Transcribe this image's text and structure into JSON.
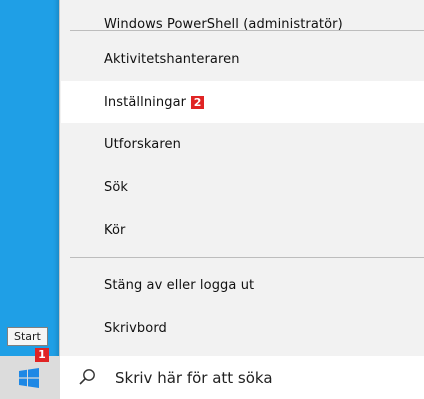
{
  "menu": {
    "items": [
      {
        "label": "Windows PowerShell (administratör)"
      },
      {
        "label": "Aktivitetshanteraren"
      },
      {
        "label": "Inställningar",
        "badge": "2"
      },
      {
        "label": "Utforskaren"
      },
      {
        "label": "Sök"
      },
      {
        "label": "Kör"
      },
      {
        "label": "Stäng av eller logga ut"
      },
      {
        "label": "Skrivbord"
      }
    ]
  },
  "start": {
    "tooltip": "Start",
    "badge": "1",
    "icon": "windows-logo-icon"
  },
  "search": {
    "placeholder": "Skriv här för att söka",
    "icon": "search-icon"
  },
  "colors": {
    "desktop": "#1f9fe6",
    "windows_logo": "#1e88e5",
    "badge": "#e02424"
  }
}
